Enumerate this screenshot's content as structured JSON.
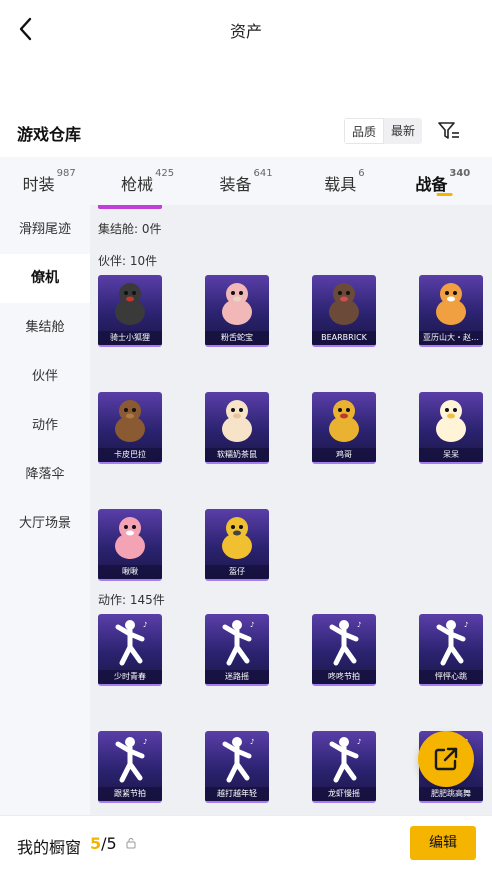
{
  "header": {
    "title": "资产",
    "back_icon": "chevron-left-icon"
  },
  "warehouse": {
    "title": "游戏仓库",
    "sort": [
      "品质",
      "最新"
    ],
    "filter_icon": "filter-icon"
  },
  "tabs": [
    {
      "label": "时装",
      "count": "987"
    },
    {
      "label": "枪械",
      "count": "425"
    },
    {
      "label": "装备",
      "count": "641"
    },
    {
      "label": "载具",
      "count": "6"
    },
    {
      "label": "战备",
      "count": "340"
    }
  ],
  "sidebar": {
    "items": [
      {
        "label": "滑翔尾迹"
      },
      {
        "label": "僚机"
      },
      {
        "label": "集结舱"
      },
      {
        "label": "伙伴"
      },
      {
        "label": "动作"
      },
      {
        "label": "降落伞"
      },
      {
        "label": "大厅场景"
      }
    ]
  },
  "groups": {
    "pod": "集结舱: 0件",
    "partners": "伙伴: 10件",
    "actions": "动作: 145件"
  },
  "partners": [
    {
      "name": "骑士小狐狸",
      "icon": "fox-knight-icon"
    },
    {
      "name": "粉舌蛇宝",
      "icon": "pink-snake-icon"
    },
    {
      "name": "BEARBRICK",
      "icon": "bearbrick-icon"
    },
    {
      "name": "亚历山大・赵…",
      "icon": "tiger-icon"
    },
    {
      "name": "卡皮巴拉",
      "icon": "capybara-icon"
    },
    {
      "name": "软糯奶茶鼠",
      "icon": "hamster-icon"
    },
    {
      "name": "鸡哥",
      "icon": "rooster-icon"
    },
    {
      "name": "呆呆",
      "icon": "chick-icon"
    },
    {
      "name": "啾啾",
      "icon": "pink-creature-icon"
    },
    {
      "name": "盔仔",
      "icon": "helmet-duck-icon"
    }
  ],
  "actions": [
    {
      "name": "少时青春",
      "icon": "dance-pose-icon"
    },
    {
      "name": "迷路摇",
      "icon": "dance-pose-icon"
    },
    {
      "name": "咚咚节拍",
      "icon": "dance-pose-icon"
    },
    {
      "name": "怦怦心跳",
      "icon": "dance-pose-icon"
    },
    {
      "name": "跟紧节拍",
      "icon": "dance-pose-icon"
    },
    {
      "name": "越打越年轻",
      "icon": "dance-pose-icon"
    },
    {
      "name": "龙虾慢摇",
      "icon": "dance-pose-icon"
    },
    {
      "name": "肥肥跳高舞",
      "icon": "dance-pose-icon"
    }
  ],
  "bottom": {
    "showcase_label": "我的橱窗",
    "showcase_current": "5",
    "showcase_sep": "/",
    "showcase_total": "5",
    "edit_label": "编辑",
    "share_icon": "external-share-icon"
  },
  "colors": {
    "accent": "#f5b400",
    "card_bg": "#2b2370",
    "card_accent": "#a77cf0"
  }
}
